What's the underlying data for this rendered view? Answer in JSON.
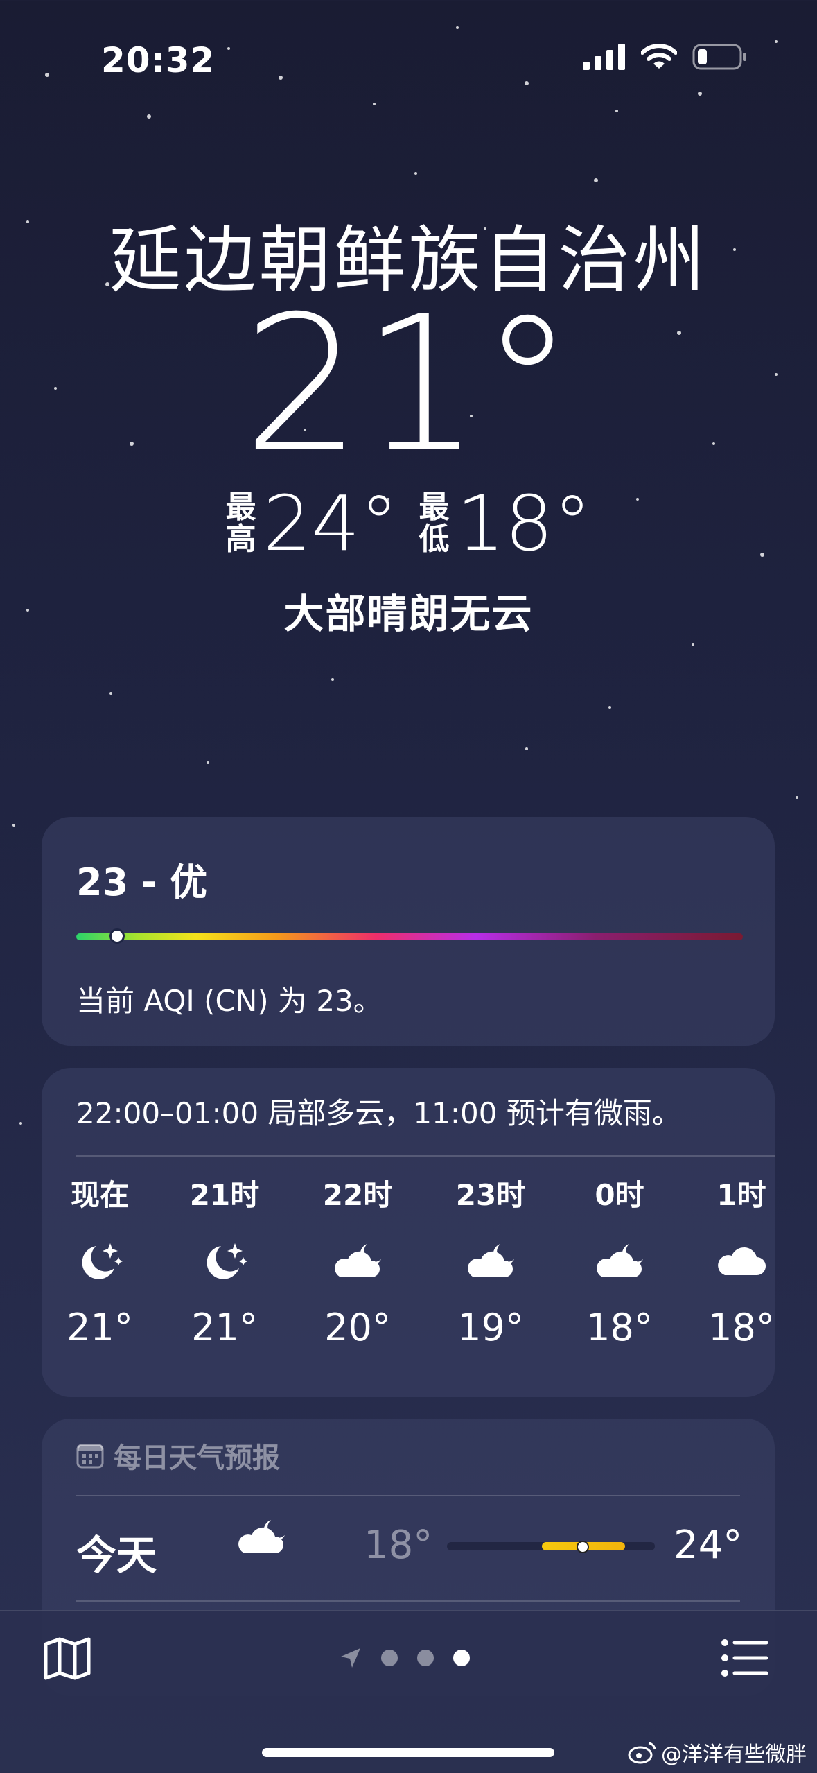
{
  "status_bar": {
    "time": "20:32"
  },
  "location": {
    "city": "延边朝鲜族自治州"
  },
  "current": {
    "temperature": "21°",
    "high_label": "最高",
    "high": "24°",
    "low_label": "最低",
    "low": "18°",
    "condition": "大部晴朗无云"
  },
  "aqi": {
    "title": "23 - 优",
    "description": "当前 AQI (CN) 为 23。",
    "level_fraction": 0.05,
    "colors": [
      "#2bd36a",
      "#f5e21b",
      "#ee2e6a",
      "#b82ee8",
      "#7a1a32"
    ]
  },
  "hourly": {
    "summary": "22:00–01:00 局部多云，11:00 预计有微雨。",
    "items": [
      {
        "label": "现在",
        "icon": "moon-stars-icon",
        "temp": "21°"
      },
      {
        "label": "21时",
        "icon": "moon-stars-icon",
        "temp": "21°"
      },
      {
        "label": "22时",
        "icon": "cloud-moon-icon",
        "temp": "20°"
      },
      {
        "label": "23时",
        "icon": "cloud-moon-icon",
        "temp": "19°"
      },
      {
        "label": "0时",
        "icon": "cloud-moon-icon",
        "temp": "18°"
      },
      {
        "label": "1时",
        "icon": "cloud-icon",
        "temp": "18°"
      }
    ]
  },
  "daily": {
    "title": "每日天气预报",
    "icon": "calendar-icon",
    "rows": [
      {
        "day": "今天",
        "icon": "cloud-moon-icon",
        "low": "18°",
        "high": "24°",
        "current_fraction": 0.5
      }
    ]
  },
  "tabbar": {
    "map_icon": "map-icon",
    "location_icon": "location-arrow-icon",
    "page_count": 3,
    "active_page": 3,
    "list_icon": "list-icon"
  },
  "watermark": {
    "text": "@洋洋有些微胖"
  }
}
